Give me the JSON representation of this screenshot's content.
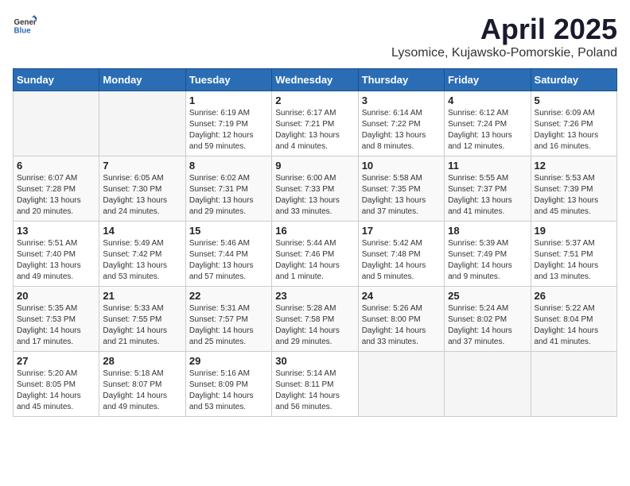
{
  "header": {
    "logo_general": "General",
    "logo_blue": "Blue",
    "title": "April 2025",
    "subtitle": "Lysomice, Kujawsko-Pomorskie, Poland"
  },
  "days_of_week": [
    "Sunday",
    "Monday",
    "Tuesday",
    "Wednesday",
    "Thursday",
    "Friday",
    "Saturday"
  ],
  "weeks": [
    [
      {
        "day": "",
        "info": ""
      },
      {
        "day": "",
        "info": ""
      },
      {
        "day": "1",
        "info": "Sunrise: 6:19 AM\nSunset: 7:19 PM\nDaylight: 12 hours and 59 minutes."
      },
      {
        "day": "2",
        "info": "Sunrise: 6:17 AM\nSunset: 7:21 PM\nDaylight: 13 hours and 4 minutes."
      },
      {
        "day": "3",
        "info": "Sunrise: 6:14 AM\nSunset: 7:22 PM\nDaylight: 13 hours and 8 minutes."
      },
      {
        "day": "4",
        "info": "Sunrise: 6:12 AM\nSunset: 7:24 PM\nDaylight: 13 hours and 12 minutes."
      },
      {
        "day": "5",
        "info": "Sunrise: 6:09 AM\nSunset: 7:26 PM\nDaylight: 13 hours and 16 minutes."
      }
    ],
    [
      {
        "day": "6",
        "info": "Sunrise: 6:07 AM\nSunset: 7:28 PM\nDaylight: 13 hours and 20 minutes."
      },
      {
        "day": "7",
        "info": "Sunrise: 6:05 AM\nSunset: 7:30 PM\nDaylight: 13 hours and 24 minutes."
      },
      {
        "day": "8",
        "info": "Sunrise: 6:02 AM\nSunset: 7:31 PM\nDaylight: 13 hours and 29 minutes."
      },
      {
        "day": "9",
        "info": "Sunrise: 6:00 AM\nSunset: 7:33 PM\nDaylight: 13 hours and 33 minutes."
      },
      {
        "day": "10",
        "info": "Sunrise: 5:58 AM\nSunset: 7:35 PM\nDaylight: 13 hours and 37 minutes."
      },
      {
        "day": "11",
        "info": "Sunrise: 5:55 AM\nSunset: 7:37 PM\nDaylight: 13 hours and 41 minutes."
      },
      {
        "day": "12",
        "info": "Sunrise: 5:53 AM\nSunset: 7:39 PM\nDaylight: 13 hours and 45 minutes."
      }
    ],
    [
      {
        "day": "13",
        "info": "Sunrise: 5:51 AM\nSunset: 7:40 PM\nDaylight: 13 hours and 49 minutes."
      },
      {
        "day": "14",
        "info": "Sunrise: 5:49 AM\nSunset: 7:42 PM\nDaylight: 13 hours and 53 minutes."
      },
      {
        "day": "15",
        "info": "Sunrise: 5:46 AM\nSunset: 7:44 PM\nDaylight: 13 hours and 57 minutes."
      },
      {
        "day": "16",
        "info": "Sunrise: 5:44 AM\nSunset: 7:46 PM\nDaylight: 14 hours and 1 minute."
      },
      {
        "day": "17",
        "info": "Sunrise: 5:42 AM\nSunset: 7:48 PM\nDaylight: 14 hours and 5 minutes."
      },
      {
        "day": "18",
        "info": "Sunrise: 5:39 AM\nSunset: 7:49 PM\nDaylight: 14 hours and 9 minutes."
      },
      {
        "day": "19",
        "info": "Sunrise: 5:37 AM\nSunset: 7:51 PM\nDaylight: 14 hours and 13 minutes."
      }
    ],
    [
      {
        "day": "20",
        "info": "Sunrise: 5:35 AM\nSunset: 7:53 PM\nDaylight: 14 hours and 17 minutes."
      },
      {
        "day": "21",
        "info": "Sunrise: 5:33 AM\nSunset: 7:55 PM\nDaylight: 14 hours and 21 minutes."
      },
      {
        "day": "22",
        "info": "Sunrise: 5:31 AM\nSunset: 7:57 PM\nDaylight: 14 hours and 25 minutes."
      },
      {
        "day": "23",
        "info": "Sunrise: 5:28 AM\nSunset: 7:58 PM\nDaylight: 14 hours and 29 minutes."
      },
      {
        "day": "24",
        "info": "Sunrise: 5:26 AM\nSunset: 8:00 PM\nDaylight: 14 hours and 33 minutes."
      },
      {
        "day": "25",
        "info": "Sunrise: 5:24 AM\nSunset: 8:02 PM\nDaylight: 14 hours and 37 minutes."
      },
      {
        "day": "26",
        "info": "Sunrise: 5:22 AM\nSunset: 8:04 PM\nDaylight: 14 hours and 41 minutes."
      }
    ],
    [
      {
        "day": "27",
        "info": "Sunrise: 5:20 AM\nSunset: 8:05 PM\nDaylight: 14 hours and 45 minutes."
      },
      {
        "day": "28",
        "info": "Sunrise: 5:18 AM\nSunset: 8:07 PM\nDaylight: 14 hours and 49 minutes."
      },
      {
        "day": "29",
        "info": "Sunrise: 5:16 AM\nSunset: 8:09 PM\nDaylight: 14 hours and 53 minutes."
      },
      {
        "day": "30",
        "info": "Sunrise: 5:14 AM\nSunset: 8:11 PM\nDaylight: 14 hours and 56 minutes."
      },
      {
        "day": "",
        "info": ""
      },
      {
        "day": "",
        "info": ""
      },
      {
        "day": "",
        "info": ""
      }
    ]
  ]
}
